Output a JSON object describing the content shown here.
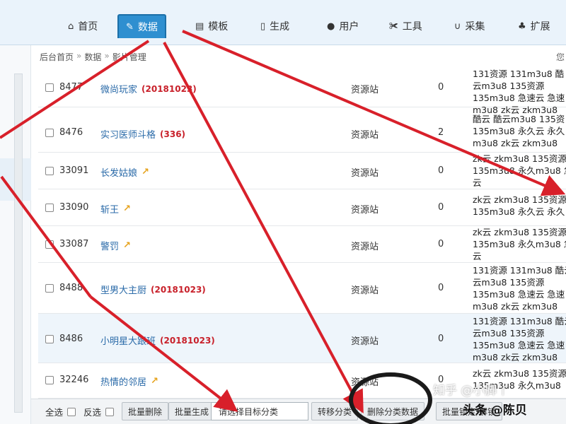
{
  "nav": {
    "tabs": [
      {
        "label": "首页",
        "icon": "home-icon",
        "glyph": "⌂"
      },
      {
        "label": "数据",
        "icon": "edit-icon",
        "glyph": "✎"
      },
      {
        "label": "模板",
        "icon": "file-icon",
        "glyph": "▤"
      },
      {
        "label": "生成",
        "icon": "page-icon",
        "glyph": "▯"
      },
      {
        "label": "用户",
        "icon": "user-icon",
        "glyph": "●"
      },
      {
        "label": "工具",
        "icon": "wrench-icon",
        "glyph": "✀"
      },
      {
        "label": "采集",
        "icon": "magnet-icon",
        "glyph": "∪"
      },
      {
        "label": "扩展",
        "icon": "sitemap-icon",
        "glyph": "♣"
      }
    ]
  },
  "breadcrumb": {
    "items": [
      "后台首页",
      "数据",
      "影片管理"
    ],
    "sep": "»"
  },
  "header_hint": "您",
  "rows": [
    {
      "id": "8477",
      "name": "微尚玩家",
      "tag": "(20181023)",
      "hot": "",
      "source": "资源站",
      "hits": "0",
      "play": [
        "131资源 131m3u8 酷",
        "云m3u8 135资源",
        "135m3u8 急速云 急速",
        "m3u8 zk云 zkm3u8"
      ]
    },
    {
      "id": "8476",
      "name": "实习医师斗格",
      "tag": "(336)",
      "hot": "",
      "source": "资源站",
      "hits": "2",
      "play": [
        "酷云 酷云m3u8 135资",
        "135m3u8 永久云 永久",
        "m3u8 zk云 zkm3u8"
      ]
    },
    {
      "id": "33091",
      "name": "长发姑娘",
      "tag": "",
      "hot": "↗",
      "source": "资源站",
      "hits": "0",
      "play": [
        "zk云 zkm3u8 135资源",
        "135m3u8 永久m3u8 急",
        "云"
      ]
    },
    {
      "id": "33090",
      "name": "斩王",
      "tag": "",
      "hot": "↗",
      "source": "资源站",
      "hits": "0",
      "play": [
        "zk云 zkm3u8 135资源",
        "135m3u8 永久云 永久"
      ]
    },
    {
      "id": "33087",
      "name": "警罚",
      "tag": "",
      "hot": "↗",
      "source": "资源站",
      "hits": "0",
      "play": [
        "zk云 zkm3u8 135资源",
        "135m3u8 永久m3u8 急",
        "云"
      ]
    },
    {
      "id": "8488",
      "name": "型男大主厨",
      "tag": "(20181023)",
      "hot": "",
      "source": "资源站",
      "hits": "0",
      "play": [
        "131资源 131m3u8 酷云",
        "云m3u8 135资源",
        "135m3u8 急速云 急速",
        "m3u8 zk云 zkm3u8"
      ]
    },
    {
      "id": "8486",
      "name": "小明星大跟班",
      "tag": "(20181023)",
      "hot": "",
      "source": "资源站",
      "hits": "0",
      "play": [
        "131资源 131m3u8 酷云",
        "云m3u8 135资源",
        "135m3u8 急速云 急速",
        "m3u8 zk云 zkm3u8"
      ]
    },
    {
      "id": "32246",
      "name": "热情的邻居",
      "tag": "",
      "hot": "↗",
      "source": "资源站",
      "hits": "0",
      "play": [
        "zk云 zkm3u8 135资源",
        "135m3u8 永久m3u8"
      ]
    }
  ],
  "toolbar": {
    "select_all": "全选",
    "invert": "反选",
    "batch_delete": "批量删除",
    "batch_generate": "批量生成",
    "target_category_placeholder": "请选择目标分类",
    "move_category": "转移分类",
    "delete_category_data": "删除分类数据",
    "batch_lock": "批量锁定/解锁"
  },
  "watermark": {
    "text": "知乎 @小脚丫",
    "subtext": "头条 @陈贝"
  },
  "colors": {
    "accent": "#2f8fd0",
    "annotation": "#d8202a",
    "tag": "#c8202a",
    "link": "#2a6aa8"
  }
}
